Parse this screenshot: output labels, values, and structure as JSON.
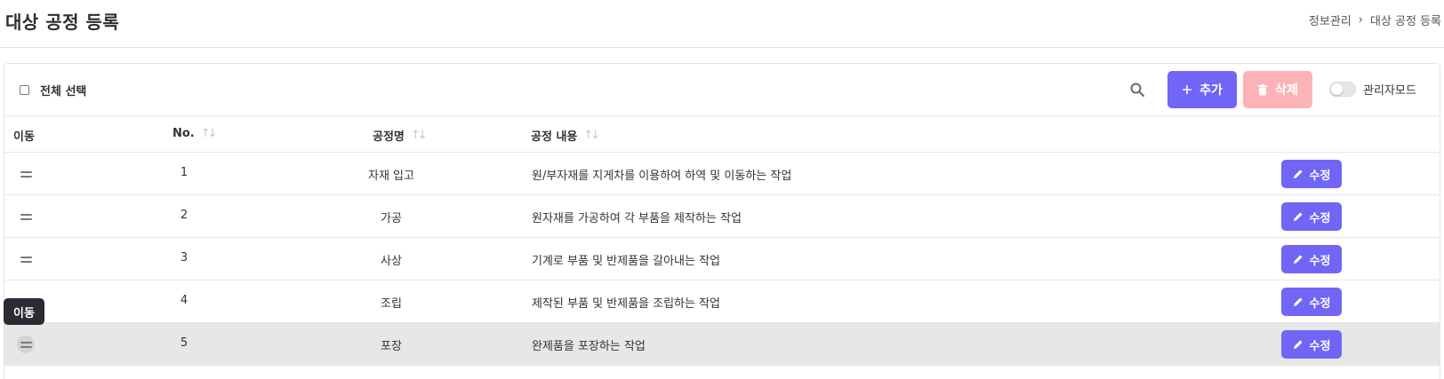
{
  "page": {
    "title": "대상 공정 등록",
    "breadcrumb": [
      "정보관리",
      "대상 공정 등록"
    ],
    "breadcrumb_separator": "›"
  },
  "toolbar": {
    "select_all_label": "전체 선택",
    "search_icon": "search-icon",
    "add_label": "추가",
    "delete_label": "삭제",
    "admin_mode_label": "관리자모드",
    "admin_mode_on": false
  },
  "table": {
    "columns": [
      "이동",
      "No.",
      "공정명",
      "공정 내용"
    ],
    "rows": [
      {
        "no": "1",
        "name": "자재 입고",
        "desc": "원/부자재를 지게차를 이용하여 하역 및 이동하는 작업",
        "edit_label": "수정"
      },
      {
        "no": "2",
        "name": "가공",
        "desc": "원자재를 가공하여 각 부품을 제작하는 작업",
        "edit_label": "수정"
      },
      {
        "no": "3",
        "name": "사상",
        "desc": "기계로 부품 및 반제품을 갈아내는 작업",
        "edit_label": "수정"
      },
      {
        "no": "4",
        "name": "조립",
        "desc": "제작된 부품 및 반제품을 조립하는 작업",
        "edit_label": "수정"
      },
      {
        "no": "5",
        "name": "포장",
        "desc": "완제품을 포장하는 작업",
        "edit_label": "수정"
      }
    ]
  },
  "tooltip": {
    "text": "이동"
  },
  "colors": {
    "primary": "#7165f6",
    "danger_disabled": "#fbb3b7",
    "hover_row": "#e7e7e7",
    "tooltip_bg": "#2b2b36"
  }
}
